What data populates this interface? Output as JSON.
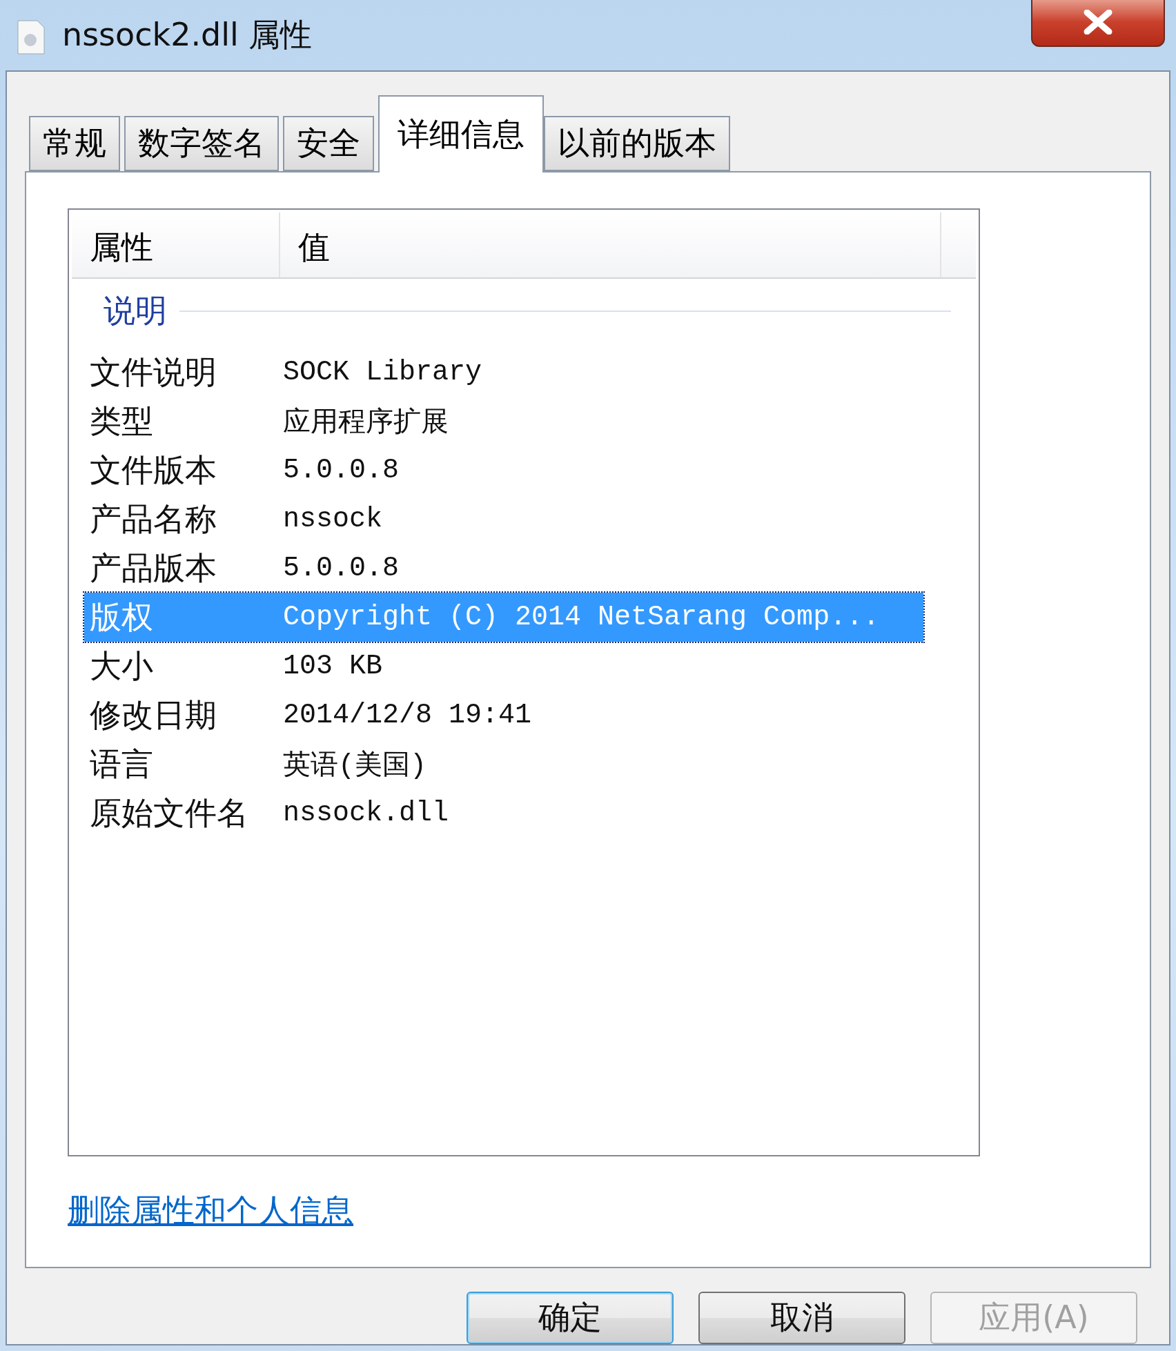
{
  "window": {
    "title": "nssock2.dll 属性"
  },
  "tabs": [
    {
      "label": "常规",
      "selected": false
    },
    {
      "label": "数字签名",
      "selected": false
    },
    {
      "label": "安全",
      "selected": false
    },
    {
      "label": "详细信息",
      "selected": true
    },
    {
      "label": "以前的版本",
      "selected": false
    }
  ],
  "table": {
    "columns": [
      "属性",
      "值"
    ],
    "group": "说明",
    "rows": [
      {
        "property": "文件说明",
        "value": "SOCK Library",
        "selected": false
      },
      {
        "property": "类型",
        "value": "应用程序扩展",
        "selected": false
      },
      {
        "property": "文件版本",
        "value": "5.0.0.8",
        "selected": false
      },
      {
        "property": "产品名称",
        "value": "nssock",
        "selected": false
      },
      {
        "property": "产品版本",
        "value": "5.0.0.8",
        "selected": false
      },
      {
        "property": "版权",
        "value": "Copyright (C) 2014 NetSarang Comp...",
        "selected": true
      },
      {
        "property": "大小",
        "value": "103 KB",
        "selected": false
      },
      {
        "property": "修改日期",
        "value": "2014/12/8 19:41",
        "selected": false
      },
      {
        "property": "语言",
        "value": "英语(美国)",
        "selected": false
      },
      {
        "property": "原始文件名",
        "value": "nssock.dll",
        "selected": false
      }
    ]
  },
  "link": "删除属性和个人信息",
  "buttons": [
    {
      "label": "确定",
      "kind": "default",
      "disabled": false
    },
    {
      "label": "取消",
      "kind": "normal",
      "disabled": false
    },
    {
      "label": "应用(A)",
      "kind": "normal",
      "disabled": true
    }
  ]
}
